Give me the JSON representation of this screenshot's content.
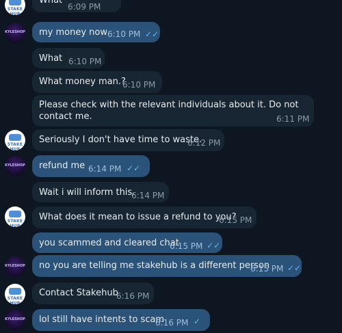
{
  "messages": [
    {
      "id": "m0",
      "dir": "in",
      "text": "What",
      "time": "6:09 PM"
    },
    {
      "id": "m1",
      "dir": "out",
      "text": "my money now",
      "time": "6:10 PM",
      "status": "double-check"
    },
    {
      "id": "m2",
      "dir": "in",
      "text": "What",
      "time": "6:10 PM"
    },
    {
      "id": "m3",
      "dir": "in",
      "text": "What money man.?",
      "time": "6:10 PM"
    },
    {
      "id": "m4",
      "dir": "in",
      "text": "Please check with the relevant individuals about it. Do not contact me.",
      "time": "6:11 PM"
    },
    {
      "id": "m5",
      "dir": "in",
      "text": "Seriously I don't have time to waste.",
      "time": "6:12 PM"
    },
    {
      "id": "m6",
      "dir": "out",
      "text": "refund me",
      "time": "6:14 PM",
      "status": "double-check"
    },
    {
      "id": "m7",
      "dir": "in",
      "text": "Wait i will inform this.",
      "time": "6:14 PM"
    },
    {
      "id": "m8",
      "dir": "in",
      "text": "What does it mean to issue a refund to you?",
      "time": "6:15 PM"
    },
    {
      "id": "m9",
      "dir": "out",
      "text": "you scammed and cleared chat",
      "time": "6:15 PM",
      "status": "double-check"
    },
    {
      "id": "m10",
      "dir": "out",
      "text": "no you are telling me stakehub is a different person",
      "time": "6:15 PM",
      "status": "double-check"
    },
    {
      "id": "m11",
      "dir": "in",
      "text": "Contact Stakehub",
      "time": "6:16 PM"
    },
    {
      "id": "m12",
      "dir": "out",
      "text": "lol still have intents to scam",
      "time": "6:16 PM",
      "status": "single-check"
    }
  ],
  "avatars": {
    "stake_label": "STAKE HUB",
    "kyle_label": "KYLESHOP"
  },
  "icons": {
    "double_check": "✓✓",
    "single_check": "✓"
  },
  "colors": {
    "background": "#0e1621",
    "incoming_bubble": "#182533",
    "outgoing_bubble": "#2b5278",
    "check_color": "#64b5ef"
  }
}
